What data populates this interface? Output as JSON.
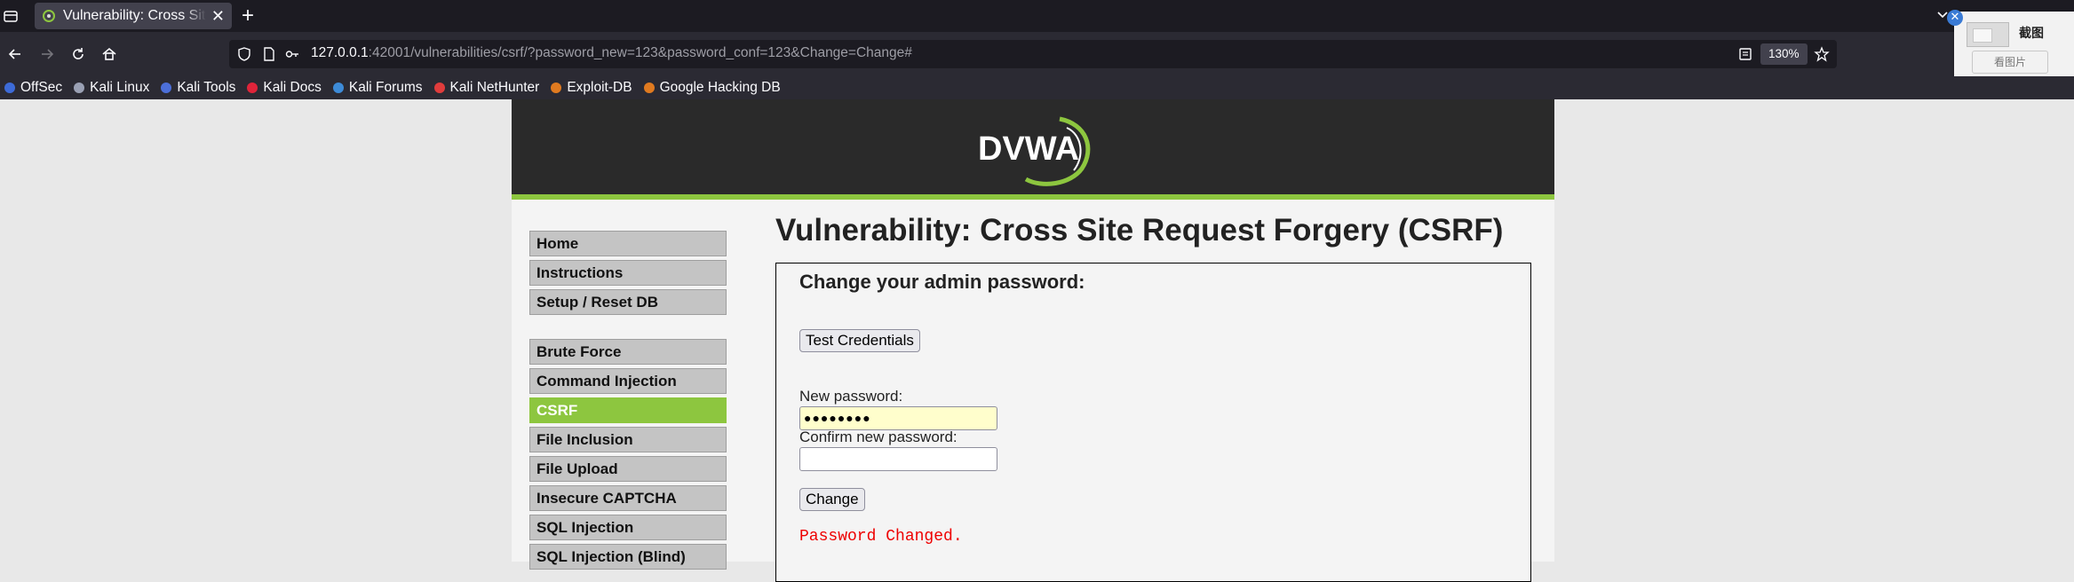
{
  "browser": {
    "tab": {
      "title": "Vulnerability: Cross Site Request Forgery (CSRF)",
      "close": "✕"
    },
    "new_tab": "+",
    "url": {
      "host": "127.0.0.1",
      "rest": ":42001/vulnerabilities/csrf/?password_new=123&password_conf=123&Change=Change#"
    },
    "zoom": "130%",
    "bookmarks": [
      {
        "label": "OffSec",
        "icon": "offsec-icon",
        "color": "#3d6bd8"
      },
      {
        "label": "Kali Linux",
        "icon": "kali-icon",
        "color": "#9aa0b4"
      },
      {
        "label": "Kali Tools",
        "icon": "kali-tools-icon",
        "color": "#4c6fd9"
      },
      {
        "label": "Kali Docs",
        "icon": "kali-docs-icon",
        "color": "#e0243a"
      },
      {
        "label": "Kali Forums",
        "icon": "kali-forums-icon",
        "color": "#3d8bd8"
      },
      {
        "label": "Kali NetHunter",
        "icon": "nethunter-icon",
        "color": "#e03c3c"
      },
      {
        "label": "Exploit-DB",
        "icon": "exploitdb-icon",
        "color": "#e07a20"
      },
      {
        "label": "Google Hacking DB",
        "icon": "ghdb-icon",
        "color": "#e07a20"
      }
    ],
    "screenshot_popup": {
      "title": "截图",
      "button": "看图片",
      "close": "✕"
    }
  },
  "page": {
    "logo": "DVWA",
    "title": "Vulnerability: Cross Site Request Forgery (CSRF)",
    "menu_group1": [
      "Home",
      "Instructions",
      "Setup / Reset DB"
    ],
    "menu_group2": [
      "Brute Force",
      "Command Injection",
      "CSRF",
      "File Inclusion",
      "File Upload",
      "Insecure CAPTCHA",
      "SQL Injection",
      "SQL Injection (Blind)"
    ],
    "active_menu": "CSRF",
    "form": {
      "heading": "Change your admin password:",
      "test_button": "Test Credentials",
      "new_password_label": "New password:",
      "new_password_value": "●●●●●●●●",
      "confirm_label": "Confirm new password:",
      "confirm_value": "",
      "change_button": "Change",
      "message": "Password Changed."
    }
  },
  "colors": {
    "accent_green": "#8dc63f",
    "header": "#2a2a2a",
    "error_red": "#e00"
  }
}
